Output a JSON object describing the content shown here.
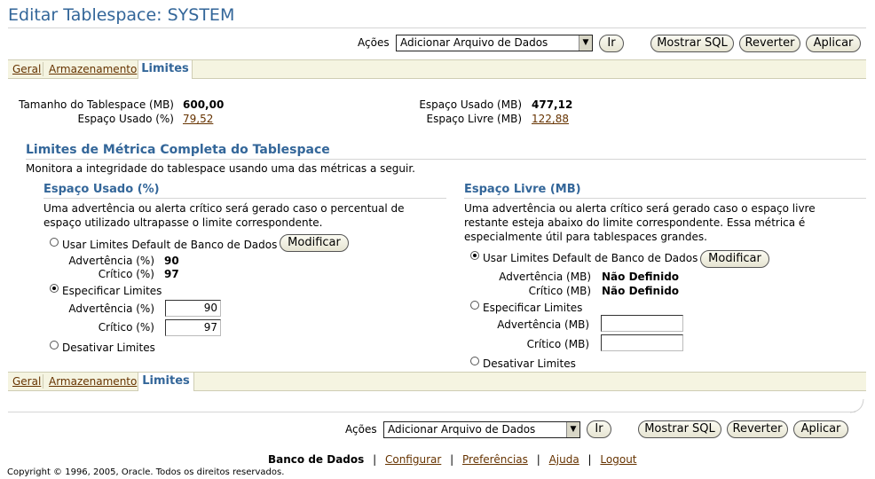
{
  "page": {
    "title": "Editar Tablespace: SYSTEM"
  },
  "actions": {
    "label": "Ações",
    "selected": "Adicionar Arquivo de Dados",
    "go": "Ir",
    "show_sql": "Mostrar SQL",
    "revert": "Reverter",
    "apply": "Aplicar"
  },
  "tabs": {
    "general": "Geral",
    "storage": "Armazenamento",
    "limits": "Limites"
  },
  "summary": {
    "size_label": "Tamanho do Tablespace (MB)",
    "size_value": "600,00",
    "used_pct_label": "Espaço Usado (%)",
    "used_pct_value": "79,52",
    "used_mb_label": "Espaço Usado (MB)",
    "used_mb_value": "477,12",
    "free_mb_label": "Espaço Livre (MB)",
    "free_mb_value": "122,88"
  },
  "section": {
    "title": "Limites de Métrica Completa do Tablespace",
    "desc": "Monitora a integridade do tablespace usando uma das métricas a seguir."
  },
  "used": {
    "title": "Espaço Usado (%)",
    "desc": "Uma advertência ou alerta crítico será gerado caso o percentual de espaço utilizado ultrapasse o limite correspondente.",
    "opt_default": "Usar Limites Default de Banco de Dados",
    "modify": "Modificar",
    "warn_label": "Advertência (%)",
    "warn_value": "90",
    "crit_label": "Crítico (%)",
    "crit_value": "97",
    "opt_specify": "Especificar Limites",
    "spec_warn_label": "Advertência (%)",
    "spec_warn_value": "90",
    "spec_crit_label": "Crítico (%)",
    "spec_crit_value": "97",
    "opt_disable": "Desativar Limites"
  },
  "free": {
    "title": "Espaço Livre (MB)",
    "desc": "Uma advertência ou alerta crítico será gerado caso o espaço livre restante esteja abaixo do limite correspondente. Essa métrica é especialmente útil para tablespaces grandes.",
    "opt_default": "Usar Limites Default de Banco de Dados",
    "modify": "Modificar",
    "warn_label": "Advertência (MB)",
    "warn_value": "Não Definido",
    "crit_label": "Crítico (MB)",
    "crit_value": "Não Definido",
    "opt_specify": "Especificar Limites",
    "spec_warn_label": "Advertência (MB)",
    "spec_warn_value": "",
    "spec_crit_label": "Crítico (MB)",
    "spec_crit_value": "",
    "opt_disable": "Desativar Limites"
  },
  "footer": {
    "database": "Banco de Dados",
    "configure": "Configurar",
    "preferences": "Preferências",
    "help": "Ajuda",
    "logout": "Logout",
    "sep": "|",
    "copyright": "Copyright © 1996, 2005, Oracle. Todos os direitos reservados."
  },
  "colors": {
    "header_blue": "#336699",
    "link_brown": "#663300",
    "tab_bg": "#f5f4e1"
  }
}
